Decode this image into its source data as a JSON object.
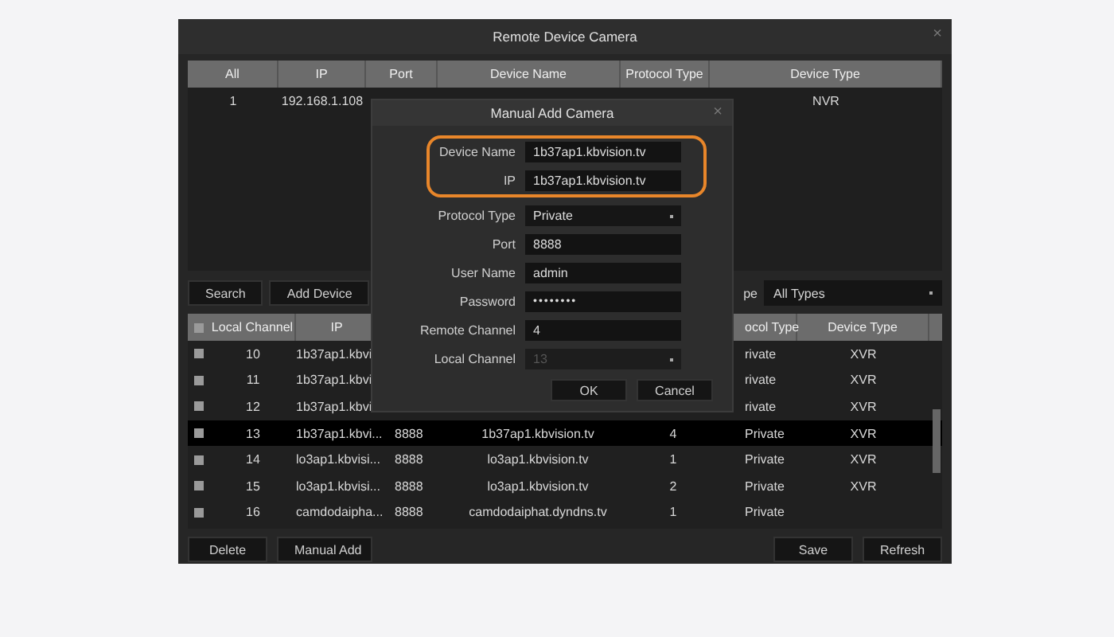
{
  "window": {
    "title": "Remote Device Camera",
    "close": "×"
  },
  "device_table": {
    "columns": [
      "All",
      "IP",
      "Port",
      "Device Name",
      "Protocol Type",
      "Device Type"
    ],
    "rows": [
      {
        "cells": [
          "1",
          "192.168.1.108",
          null,
          null,
          null,
          "NVR"
        ]
      }
    ]
  },
  "toolbar": {
    "buttons": [
      "Search",
      "Add Device"
    ],
    "filter_label": "pe",
    "filter_value": "All Types"
  },
  "added_table": {
    "columns": [
      "Local Channel",
      "IP",
      null,
      null,
      null,
      "ocol Type",
      "Device Type"
    ],
    "header_checked": false,
    "rows": [
      {
        "checked": false,
        "selected": false,
        "cells": [
          "10",
          "1b37ap1.kbvi",
          null,
          null,
          null,
          "rivate",
          "XVR"
        ]
      },
      {
        "checked": false,
        "selected": false,
        "cells": [
          "11",
          "1b37ap1.kbvi",
          null,
          null,
          null,
          "rivate",
          "XVR"
        ]
      },
      {
        "checked": false,
        "selected": false,
        "cells": [
          "12",
          "1b37ap1.kbvi",
          null,
          null,
          null,
          "rivate",
          "XVR"
        ]
      },
      {
        "checked": false,
        "selected": true,
        "cells": [
          "13",
          "1b37ap1.kbvi...",
          "8888",
          "1b37ap1.kbvision.tv",
          "4",
          "Private",
          "XVR"
        ]
      },
      {
        "checked": false,
        "selected": false,
        "cells": [
          "14",
          "lo3ap1.kbvisi...",
          "8888",
          "lo3ap1.kbvision.tv",
          "1",
          "Private",
          "XVR"
        ]
      },
      {
        "checked": false,
        "selected": false,
        "cells": [
          "15",
          "lo3ap1.kbvisi...",
          "8888",
          "lo3ap1.kbvision.tv",
          "2",
          "Private",
          "XVR"
        ]
      },
      {
        "checked": false,
        "selected": false,
        "cells": [
          "16",
          "camdodaipha...",
          "8888",
          "camdodaiphat.dyndns.tv",
          "1",
          "Private",
          null
        ]
      }
    ]
  },
  "bottom_buttons": [
    "Delete",
    "Manual Add",
    "Save",
    "Refresh"
  ],
  "dialog": {
    "title": "Manual Add Camera",
    "close": "×",
    "fields": [
      {
        "label": "Device Name",
        "value": "1b37ap1.kbvision.tv",
        "kind": "text",
        "highlighted": true
      },
      {
        "label": "IP",
        "value": "1b37ap1.kbvision.tv",
        "kind": "text",
        "highlighted": true
      },
      {
        "label": "Protocol Type",
        "value": "Private",
        "kind": "select",
        "highlighted": false,
        "disabled": false
      },
      {
        "label": "Port",
        "value": "8888",
        "kind": "text",
        "highlighted": false
      },
      {
        "label": "User Name",
        "value": "admin",
        "kind": "text",
        "highlighted": false
      },
      {
        "label": "Password",
        "value": "••••••••",
        "kind": "password",
        "highlighted": false
      },
      {
        "label": "Remote Channel",
        "value": "4",
        "kind": "text",
        "highlighted": false
      },
      {
        "label": "Local Channel",
        "value": "13",
        "kind": "select",
        "highlighted": false,
        "disabled": true
      }
    ],
    "buttons": [
      "OK",
      "Cancel"
    ]
  }
}
